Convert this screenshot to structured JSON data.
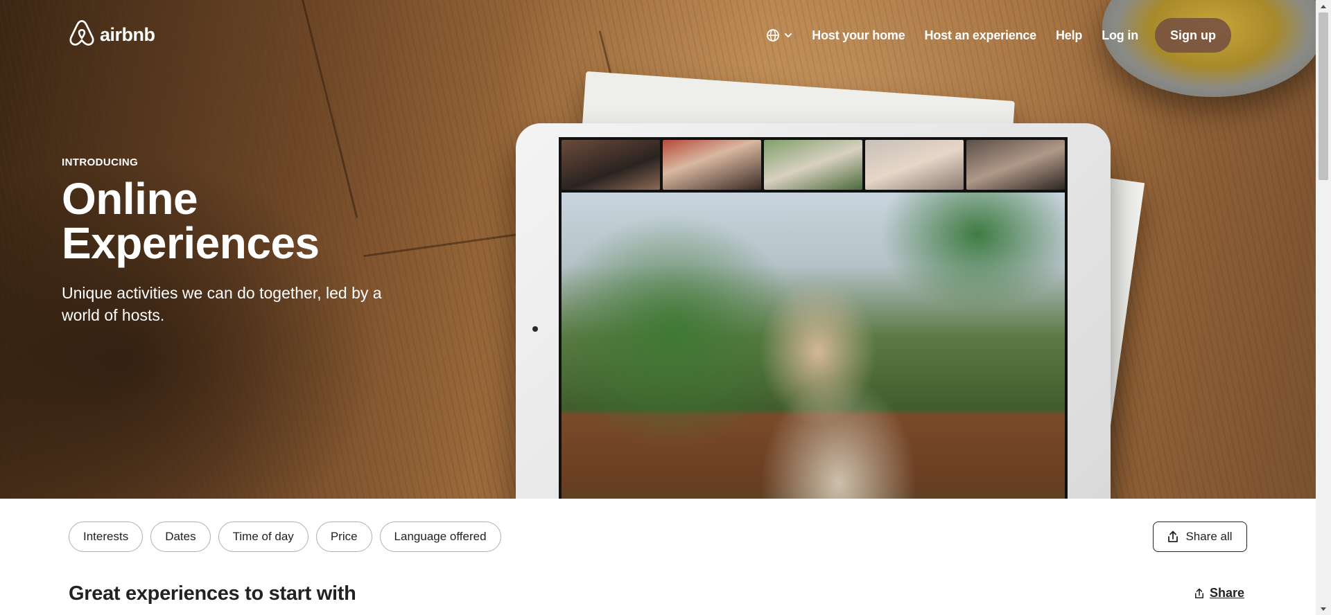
{
  "header": {
    "logo_text": "airbnb",
    "nav": {
      "globe_icon": "globe-icon",
      "host_home": "Host your home",
      "host_experience": "Host an experience",
      "help": "Help",
      "login": "Log in",
      "signup": "Sign up"
    }
  },
  "hero": {
    "eyebrow": "INTRODUCING",
    "title": "Online Experiences",
    "subtitle": "Unique activities we can do together, led by a world of hosts."
  },
  "filters": {
    "pills": [
      "Interests",
      "Dates",
      "Time of day",
      "Price",
      "Language offered"
    ],
    "share_all": "Share all",
    "share_icon": "share-icon"
  },
  "section": {
    "title": "Great experiences to start with",
    "share": "Share"
  },
  "colors": {
    "signup_bg": "#785440",
    "text": "#222222",
    "pill_border": "#b0b0b0"
  }
}
